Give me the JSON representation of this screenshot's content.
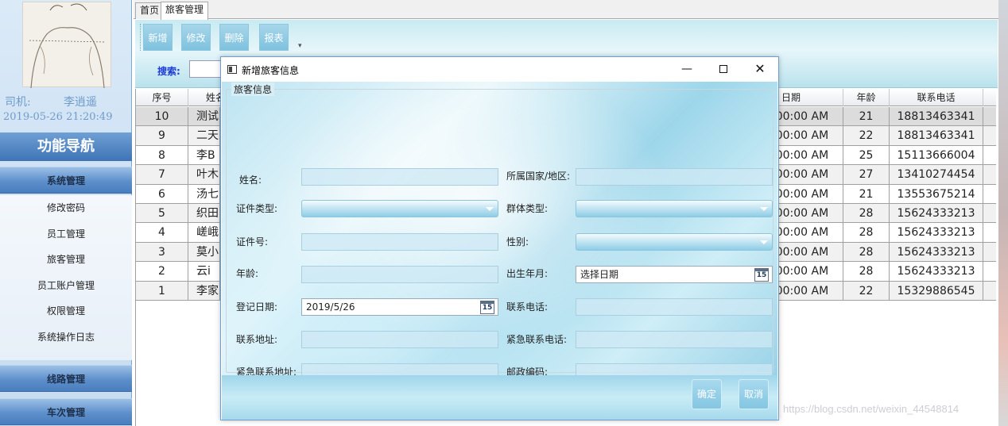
{
  "sidebar": {
    "driver_label": "司机:",
    "driver_name": "李逍遥",
    "login_time": "2019-05-26 21:20:49",
    "nav_title": "功能导航",
    "groups": {
      "system": "系统管理",
      "route": "线路管理",
      "train": "车次管理"
    },
    "system_items": [
      "修改密码",
      "员工管理",
      "旅客管理",
      "员工账户管理",
      "权限管理",
      "系统操作日志"
    ]
  },
  "tabs": [
    "首页",
    "旅客管理"
  ],
  "toolbar": {
    "add": "新增",
    "edit": "修改",
    "delete": "删除",
    "report": "报表",
    "overflow": "▾",
    "search_label": "搜索:"
  },
  "grid": {
    "headers": {
      "seq": "序号",
      "name": "姓名",
      "date": "日期",
      "age": "年龄",
      "phone": "联系电话"
    },
    "rows": [
      {
        "seq": "10",
        "name": "测试(",
        "date": ":00:00 AM",
        "age": "21",
        "phone": "18813463341"
      },
      {
        "seq": "9",
        "name": "二天之i",
        "date": ":00:00 AM",
        "age": "22",
        "phone": "18813463341"
      },
      {
        "seq": "8",
        "name": "李B",
        "date": ":00:00 AM",
        "age": "25",
        "phone": "15113666004"
      },
      {
        "seq": "7",
        "name": "叶木",
        "date": ":00:00 AM",
        "age": "27",
        "phone": "13410274454"
      },
      {
        "seq": "6",
        "name": "汤七",
        "date": ":00:00 AM",
        "age": "21",
        "phone": "13553675214"
      },
      {
        "seq": "5",
        "name": "织田",
        "date": ":00:00 AM",
        "age": "28",
        "phone": "15624333213"
      },
      {
        "seq": "4",
        "name": "嵯峨i",
        "date": ":00:00 AM",
        "age": "28",
        "phone": "15624333213"
      },
      {
        "seq": "3",
        "name": "莫小",
        "date": ":00:00 AM",
        "age": "28",
        "phone": "15624333213"
      },
      {
        "seq": "2",
        "name": "云i",
        "date": ":00:00 AM",
        "age": "28",
        "phone": "15624333213"
      },
      {
        "seq": "1",
        "name": "李家",
        "date": ":00:00 AM",
        "age": "22",
        "phone": "15329886545"
      }
    ]
  },
  "dialog": {
    "title": "新增旅客信息",
    "group_title": "旅客信息",
    "controls": {
      "minimize": "—",
      "close": "✕"
    },
    "fields": {
      "name": "姓名:",
      "country": "所属国家/地区:",
      "id_type": "证件类型:",
      "group_type": "群体类型:",
      "id_number": "证件号:",
      "gender": "性别:",
      "age": "年龄:",
      "birth": "出生年月:",
      "reg_date": "登记日期:",
      "phone": "联系电话:",
      "address": "联系地址:",
      "emergency_phone": "紧急联系电话:",
      "emergency_address": "紧急联系地址:",
      "postcode": "邮政编码:"
    },
    "values": {
      "birth_placeholder": "选择日期",
      "reg_date": "2019/5/26",
      "calendar_day": "15"
    },
    "buttons": {
      "ok": "确定",
      "cancel": "取消"
    }
  },
  "watermark": "https://blog.csdn.net/weixin_44548814"
}
